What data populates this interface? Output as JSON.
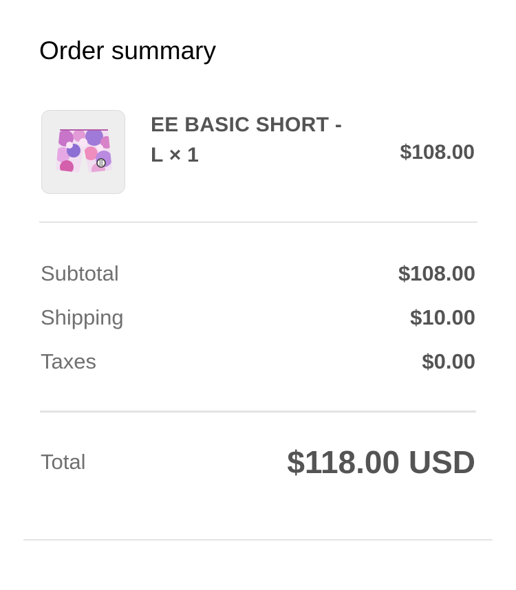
{
  "summary": {
    "title": "Order summary"
  },
  "item": {
    "name": "EE BASIC SHORT -",
    "variant_qty": "L × 1",
    "price": "$108.00",
    "image_icon": "shorts-product-image"
  },
  "costs": {
    "subtotal_label": "Subtotal",
    "subtotal_value": "$108.00",
    "shipping_label": "Shipping",
    "shipping_value": "$10.00",
    "taxes_label": "Taxes",
    "taxes_value": "$0.00"
  },
  "total": {
    "label": "Total",
    "amount": "$118.00",
    "currency": "USD"
  }
}
